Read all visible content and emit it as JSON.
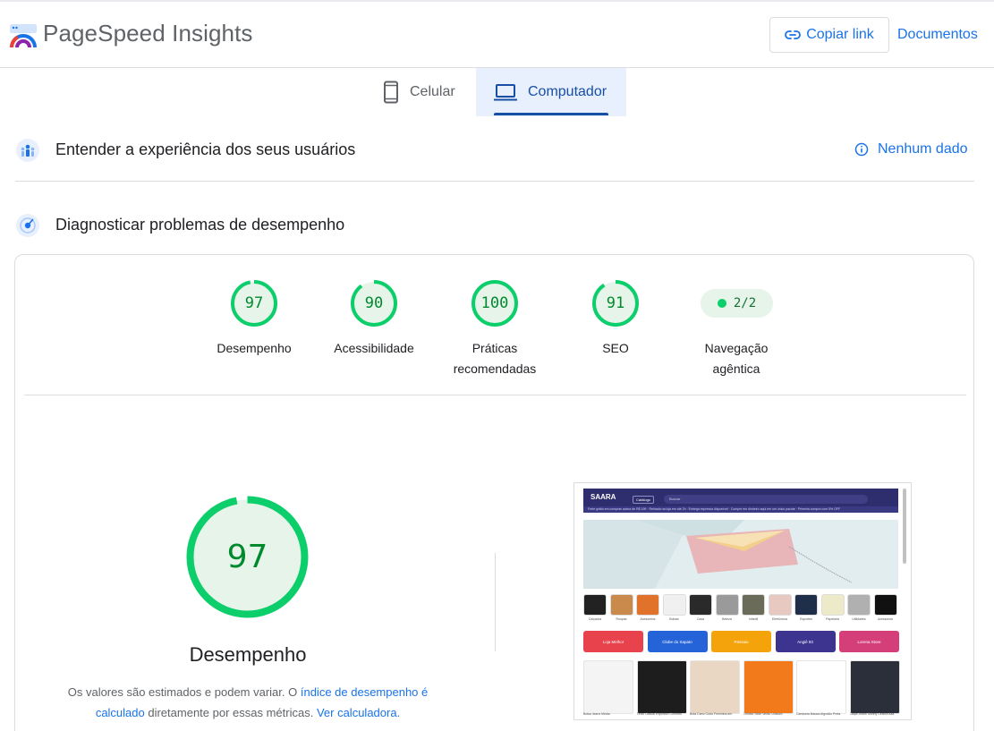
{
  "header": {
    "app_title": "PageSpeed Insights",
    "copy_link_label": "Copiar link",
    "docs_label": "Documentos",
    "logo_icon": "pagespeed-logo"
  },
  "tabs": [
    {
      "label": "Celular",
      "icon": "phone-icon",
      "selected": false
    },
    {
      "label": "Computador",
      "icon": "laptop-icon",
      "selected": true
    }
  ],
  "field_section": {
    "title": "Entender a experiência dos seus usuários",
    "no_data_label": "Nenhum dado",
    "icon": "users-icon"
  },
  "lab_section": {
    "title": "Diagnosticar problemas de desempenho",
    "icon": "radar-icon"
  },
  "scores": [
    {
      "value": "97",
      "label_line1": "Desempenho",
      "label_line2": "",
      "fraction": 0.97
    },
    {
      "value": "90",
      "label_line1": "Acessibilidade",
      "label_line2": "",
      "fraction": 0.9
    },
    {
      "value": "100",
      "label_line1": "Práticas",
      "label_line2": "recomendadas",
      "fraction": 1.0
    },
    {
      "value": "91",
      "label_line1": "SEO",
      "label_line2": "",
      "fraction": 0.91
    }
  ],
  "agentic": {
    "value": "2/2",
    "label_line1": "Navegação",
    "label_line2": "agêntica"
  },
  "performance": {
    "score": "97",
    "fraction": 0.97,
    "label": "Desempenho",
    "desc_part1": "Os valores são estimados e podem variar. O ",
    "desc_link1": "índice de desempenho é calculado",
    "desc_part2": " diretamente por essas métricas. ",
    "desc_link2": "Ver calculadora."
  },
  "colors": {
    "pass": "#0cce6b",
    "pass_text": "#008a2e",
    "link": "#1a73e8",
    "tab_bg": "#e8f0fe"
  },
  "thumbnail": {
    "logo": "SAARA",
    "categories_btn": "Catálogo",
    "search_placeholder": "Buscar",
    "promo": "Frete grátis em compras acima de R$ 199   ·   Retirada na loja em até 2h   ·   Entrega expressa disponível   ·   Compre em dinheiro aqui em um único pacote   ·   Primeira compra com 5% OFF",
    "category_labels": [
      "Calçados",
      "Roupas",
      "Acessórios",
      "Bolsas",
      "Casa",
      "Beleza",
      "Infantil",
      "Eletrônicos",
      "Esportes",
      "Papelaria",
      "Utilidades",
      "Acessórios"
    ],
    "brands": [
      "Loja Melhor",
      "Clube do Sapato",
      "Passaio",
      "Angiê 93",
      "Lorena Store"
    ],
    "products": [
      "Bolsa Jeans Média",
      "Tênis Casual Esportivo Conforto",
      "Bota Cano Curto Feminina em",
      "Chinelo Slide Verão Unissex",
      "Camiseta Básica Algodão Preta",
      "Calça Jeans Skinny Cintura Alta"
    ]
  }
}
